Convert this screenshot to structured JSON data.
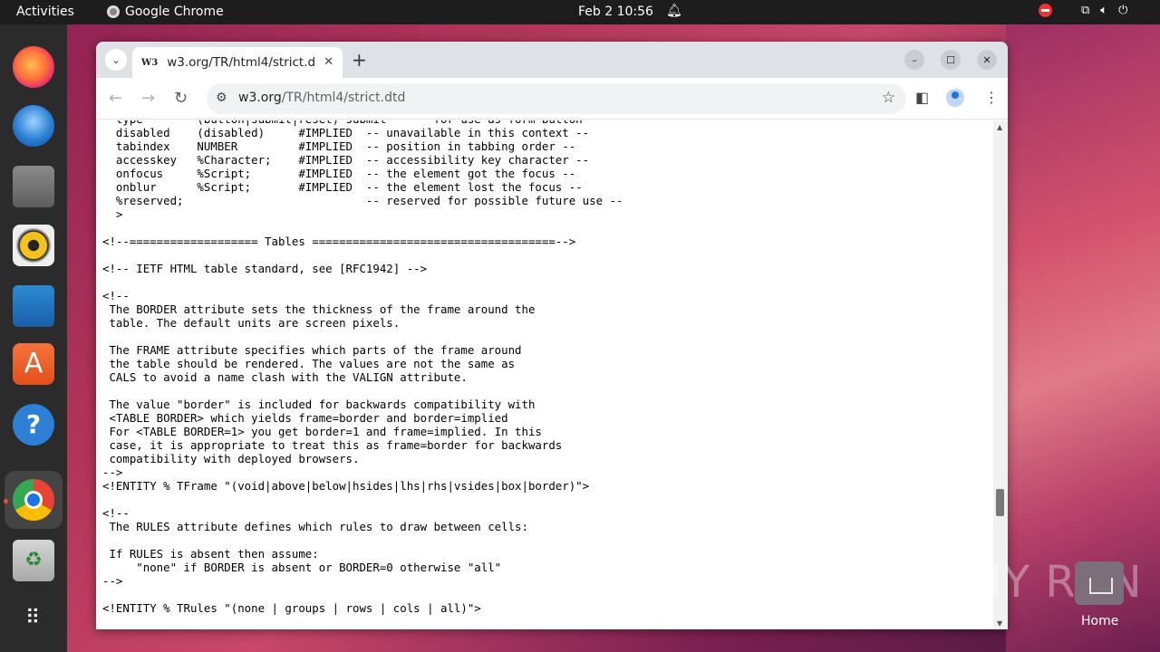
{
  "topbar": {
    "activities": "Activities",
    "app_name": "Google Chrome",
    "clock": "Feb 2  10:56"
  },
  "browser": {
    "tab_title": "w3.org/TR/html4/strict.d",
    "tab_favicon": "W3",
    "url_host": "w3.org",
    "url_path": "/TR/html4/strict.dtd"
  },
  "content": {
    "lines": [
      "  type        (button|submit|reset) submit    -- for use as form button",
      "  disabled    (disabled)     #IMPLIED  -- unavailable in this context --",
      "  tabindex    NUMBER         #IMPLIED  -- position in tabbing order --",
      "  accesskey   %Character;    #IMPLIED  -- accessibility key character --",
      "  onfocus     %Script;       #IMPLIED  -- the element got the focus --",
      "  onblur      %Script;       #IMPLIED  -- the element lost the focus --",
      "  %reserved;                           -- reserved for possible future use --",
      "  >",
      "",
      "<!--=================== Tables ====================================-->",
      "",
      "<!-- IETF HTML table standard, see [RFC1942] -->",
      "",
      "<!--",
      " The BORDER attribute sets the thickness of the frame around the",
      " table. The default units are screen pixels.",
      "",
      " The FRAME attribute specifies which parts of the frame around",
      " the table should be rendered. The values are not the same as",
      " CALS to avoid a name clash with the VALIGN attribute.",
      "",
      " The value \"border\" is included for backwards compatibility with",
      " <TABLE BORDER> which yields frame=border and border=implied",
      " For <TABLE BORDER=1> you get border=1 and frame=implied. In this",
      " case, it is appropriate to treat this as frame=border for backwards",
      " compatibility with deployed browsers.",
      "-->",
      "<!ENTITY % TFrame \"(void|above|below|hsides|lhs|rhs|vsides|box|border)\">",
      "",
      "<!--",
      " The RULES attribute defines which rules to draw between cells:",
      "",
      " If RULES is absent then assume:",
      "     \"none\" if BORDER is absent or BORDER=0 otherwise \"all\"",
      "-->",
      "",
      "<!ENTITY % TRules \"(none | groups | rows | cols | all)\">"
    ]
  },
  "desktop": {
    "home_label": "Home",
    "watermark": "ANY RUN"
  },
  "icons": {
    "dock": [
      "firefox-icon",
      "thunderbird-icon",
      "files-icon",
      "rhythmbox-icon",
      "libreoffice-writer-icon",
      "app-center-icon",
      "help-icon",
      "chrome-icon",
      "trash-icon",
      "show-apps-icon"
    ]
  }
}
